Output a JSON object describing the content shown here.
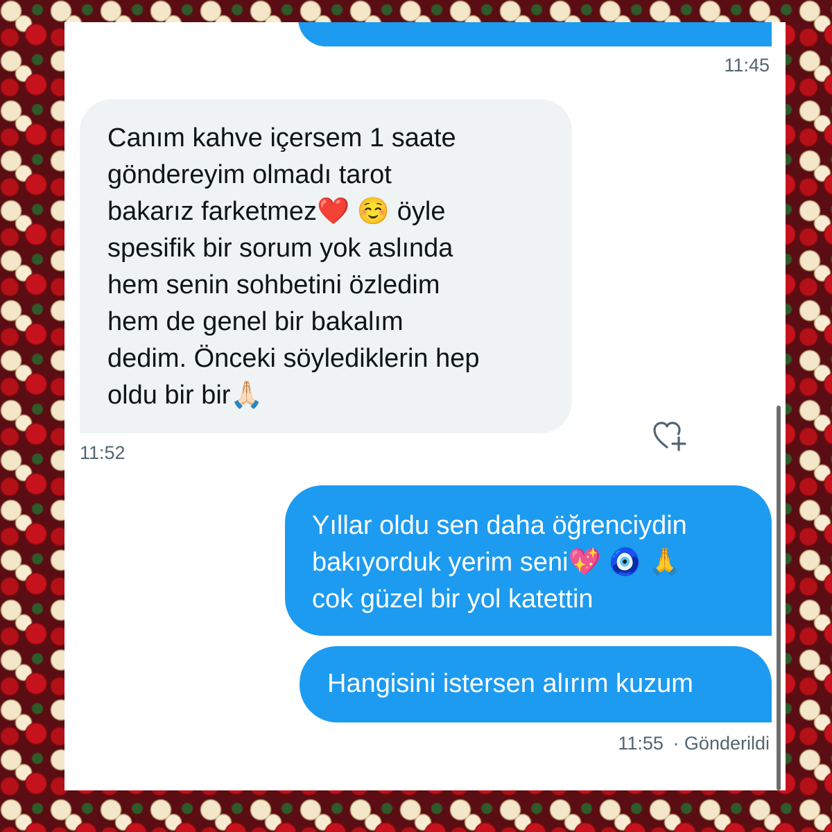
{
  "conversation": {
    "messages": [
      {
        "id": "m1",
        "direction": "outgoing",
        "lines": [],
        "time": "11:45"
      },
      {
        "id": "m2",
        "direction": "incoming",
        "lines": [
          "Canım kahve içersem 1 saate",
          "göndereyim olmadı tarot",
          "bakarız farketmez❤️ ☺️  öyle",
          "spesifik bir sorum yok aslında",
          "hem senin sohbetini özledim",
          "hem de genel bir bakalım",
          "dedim. Önceki söylediklerin hep",
          "oldu bir bir🙏🏻"
        ],
        "time": "11:52"
      },
      {
        "id": "m3",
        "direction": "outgoing",
        "lines": [
          "Yıllar oldu sen daha öğrenciydin",
          "bakıyorduk yerim seni💖 🧿 🙏",
          "cok güzel bir yol katettin"
        ]
      },
      {
        "id": "m4",
        "direction": "outgoing",
        "lines": [
          "Hangisini istersen alırım kuzum"
        ],
        "time": "11:55",
        "status": "· Gönderildi"
      }
    ]
  },
  "icons": {
    "react": "heart-plus-icon"
  },
  "colors": {
    "outgoing_bubble": "#1d9bf0",
    "incoming_bubble": "#eff3f4",
    "timestamp": "#536471",
    "text": "#0f1419"
  }
}
